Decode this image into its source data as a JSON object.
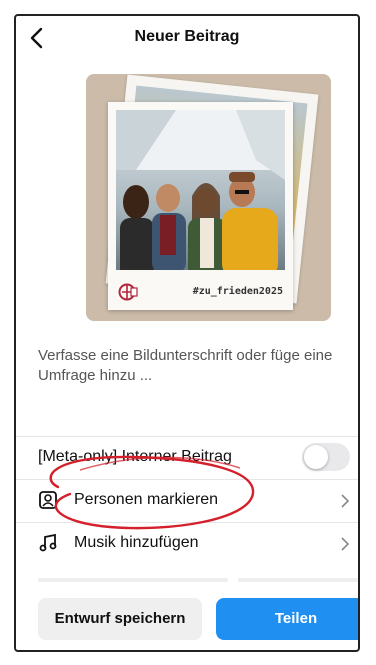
{
  "header": {
    "title": "Neuer Beitrag",
    "back_icon": "chevron-left-icon"
  },
  "preview": {
    "hashtag": "#zu_frieden2025",
    "logo_icon": "organization-logo-icon"
  },
  "caption": {
    "placeholder": "Verfasse eine Bildunterschrift oder füge eine Umfrage hinzu ..."
  },
  "settings": {
    "meta": {
      "label": "[Meta-only] Interner Beitrag",
      "toggle_on": false
    },
    "tag_people": {
      "label": "Personen markieren",
      "icon": "person-tag-icon"
    },
    "music": {
      "label": "Musik hinzufügen",
      "icon": "music-note-icon"
    }
  },
  "actions": {
    "draft_label": "Entwurf speichern",
    "share_label": "Teilen"
  },
  "colors": {
    "accent": "#1f8ff2",
    "annotation": "#d4202a"
  }
}
